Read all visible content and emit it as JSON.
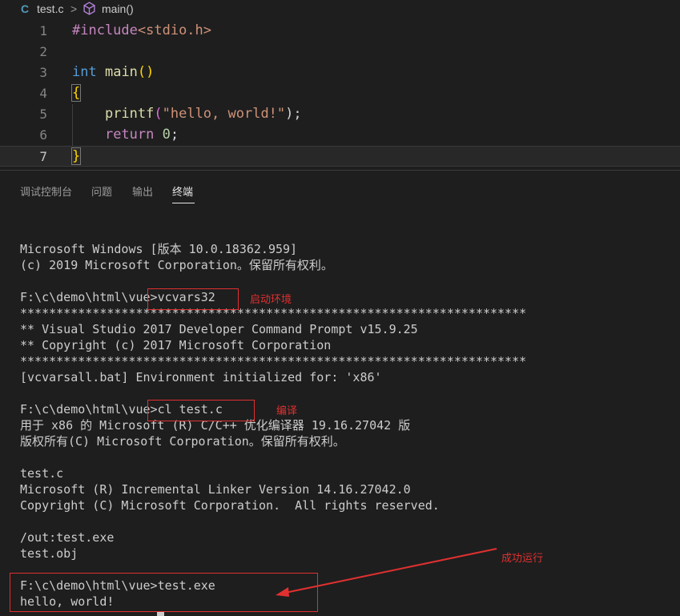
{
  "breadcrumb": {
    "lang_icon": "C",
    "file": "test.c",
    "separator": ">",
    "symbol_icon": "cube-symbol-icon",
    "symbol": "main()"
  },
  "editor": {
    "line_numbers": [
      "1",
      "2",
      "3",
      "4",
      "5",
      "6",
      "7"
    ],
    "line1": {
      "directive": "#include",
      "header": "<stdio.h>"
    },
    "line3": {
      "type": "int",
      "name": "main",
      "parens": "()"
    },
    "line4": {
      "brace": "{"
    },
    "line5": {
      "indent": "    ",
      "fn": "printf",
      "open": "(",
      "str": "\"hello, world!\"",
      "close": ");"
    },
    "line6": {
      "indent": "    ",
      "kw": "return",
      "num": "0",
      "end": ";"
    },
    "line7": {
      "brace": "}"
    }
  },
  "panel": {
    "tabs": [
      "调试控制台",
      "问题",
      "输出",
      "终端"
    ],
    "active_tab": "终端"
  },
  "terminal": {
    "lines": [
      "Microsoft Windows [版本 10.0.18362.959]",
      "(c) 2019 Microsoft Corporation。保留所有权利。",
      "",
      "F:\\c\\demo\\html\\vue>vcvars32",
      "**********************************************************************",
      "** Visual Studio 2017 Developer Command Prompt v15.9.25",
      "** Copyright (c) 2017 Microsoft Corporation",
      "**********************************************************************",
      "[vcvarsall.bat] Environment initialized for: 'x86'",
      "",
      "F:\\c\\demo\\html\\vue>cl test.c",
      "用于 x86 的 Microsoft (R) C/C++ 优化编译器 19.16.27042 版",
      "版权所有(C) Microsoft Corporation。保留所有权利。",
      "",
      "test.c",
      "Microsoft (R) Incremental Linker Version 14.16.27042.0",
      "Copyright (C) Microsoft Corporation.  All rights reserved.",
      "",
      "/out:test.exe",
      "test.obj",
      "",
      "F:\\c\\demo\\html\\vue>test.exe",
      "hello, world!"
    ]
  },
  "annotations": {
    "note1": "启动环境",
    "note2": "编译",
    "note3": "成功运行",
    "color": "#e03030"
  }
}
